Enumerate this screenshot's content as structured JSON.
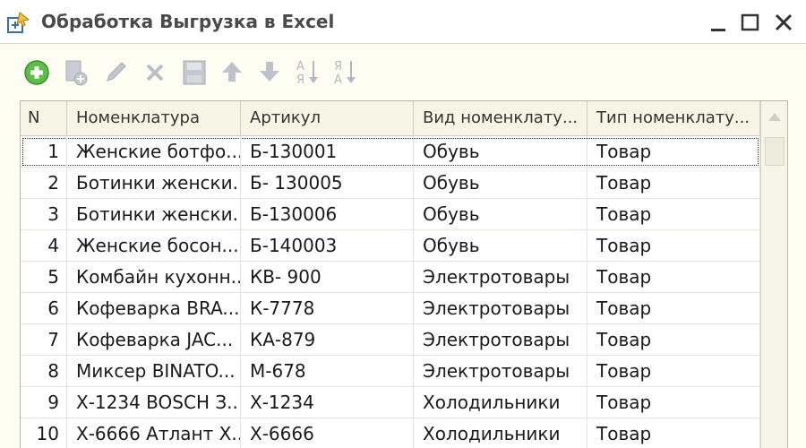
{
  "window": {
    "title": "Обработка  Выгрузка в Excel"
  },
  "toolbar": {
    "buttons": [
      {
        "name": "add-button",
        "icon": "plus-circle-icon",
        "enabled": true
      },
      {
        "name": "copy-button",
        "icon": "copy-icon",
        "enabled": false
      },
      {
        "name": "edit-button",
        "icon": "pencil-icon",
        "enabled": false
      },
      {
        "name": "delete-button",
        "icon": "x-icon",
        "enabled": false
      },
      {
        "name": "end-edit-button",
        "icon": "save-icon",
        "enabled": false
      },
      {
        "name": "move-up-button",
        "icon": "arrow-up-icon",
        "enabled": false
      },
      {
        "name": "move-down-button",
        "icon": "arrow-down-icon",
        "enabled": false
      },
      {
        "name": "sort-asc-button",
        "icon": "sort-az-icon",
        "enabled": false
      },
      {
        "name": "sort-desc-button",
        "icon": "sort-za-icon",
        "enabled": false
      }
    ]
  },
  "table": {
    "headers": {
      "n": "N",
      "nomenclature": "Номенклатура",
      "article": "Артикул",
      "kind": "Вид номенклату...",
      "type": "Тип номенклату..."
    },
    "rows": [
      {
        "n": "1",
        "nomenclature": "Женские ботфо...",
        "article": "Б-130001",
        "kind": "Обувь",
        "type": "Товар"
      },
      {
        "n": "2",
        "nomenclature": "Ботинки женски...",
        "article": "Б- 130005",
        "kind": "Обувь",
        "type": "Товар"
      },
      {
        "n": "3",
        "nomenclature": "Ботинки женски...",
        "article": "Б-130006",
        "kind": "Обувь",
        "type": "Товар"
      },
      {
        "n": "4",
        "nomenclature": "Женские босон...",
        "article": "Б-140003",
        "kind": "Обувь",
        "type": "Товар"
      },
      {
        "n": "5",
        "nomenclature": "Комбайн кухонн...",
        "article": "КВ- 900",
        "kind": "Электротовары",
        "type": "Товар"
      },
      {
        "n": "6",
        "nomenclature": "Кофеварка BRA...",
        "article": "К-7778",
        "kind": "Электротовары",
        "type": "Товар"
      },
      {
        "n": "7",
        "nomenclature": "Кофеварка JAC...",
        "article": "КА-879",
        "kind": "Электротовары",
        "type": "Товар"
      },
      {
        "n": "8",
        "nomenclature": "Миксер BINATO...",
        "article": "М-678",
        "kind": "Электротовары",
        "type": "Товар"
      },
      {
        "n": "9",
        "nomenclature": "Х-1234 BOSCH З...",
        "article": "Х-1234",
        "kind": "Холодильники",
        "type": "Товар"
      },
      {
        "n": "10",
        "nomenclature": "Х-6666 Атлант Х...",
        "article": "Х-6666",
        "kind": "Холодильники",
        "type": "Товар"
      }
    ]
  },
  "colors": {
    "accent_green": "#4caf3e",
    "disabled_icon": "#b9bfc7",
    "window_bg": "#fdfdf2"
  }
}
